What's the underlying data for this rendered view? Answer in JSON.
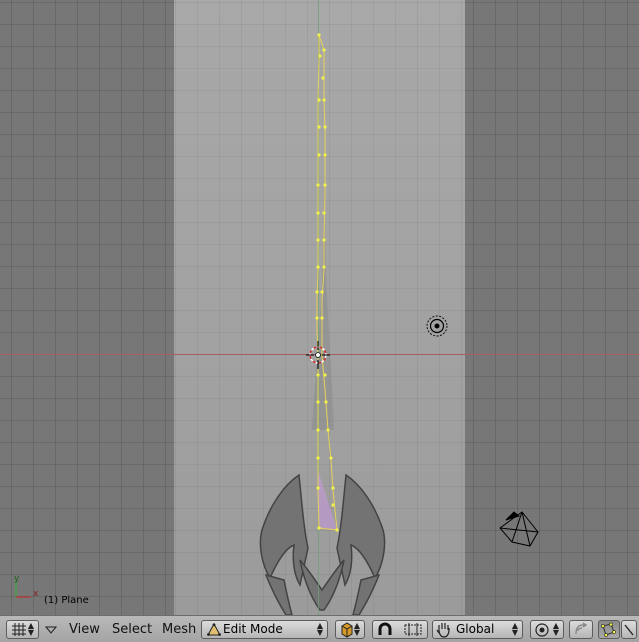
{
  "viewport": {
    "object_label": "(1) Plane",
    "axis_x_label": "x",
    "axis_y_label": "y"
  },
  "header": {
    "menus": {
      "view": "View",
      "select": "Select",
      "mesh": "Mesh"
    },
    "mode_select": "Edit Mode",
    "orientation_select": "Global"
  },
  "colors": {
    "viewport_background": "#777777",
    "reference_panel": "#a5a5a5",
    "vertex": "#f2f24a",
    "edge": "#e6d25a",
    "selected_face": "#b89ac8",
    "x_axis": "#a36060",
    "y_axis": "#6fa06f"
  }
}
